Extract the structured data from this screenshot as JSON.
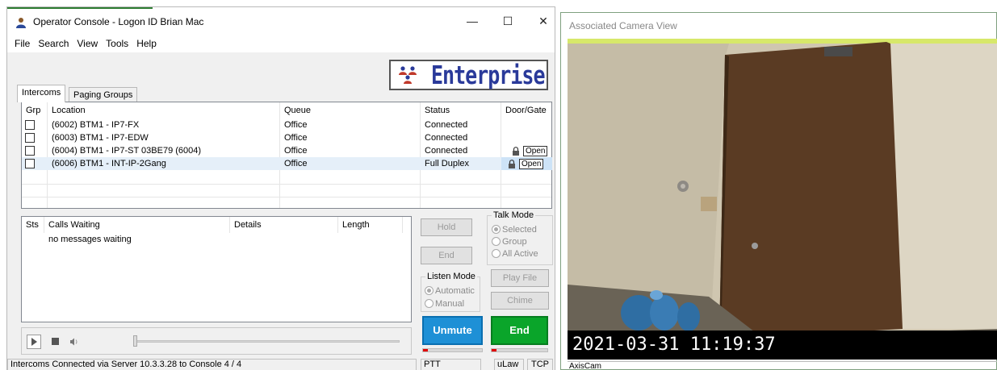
{
  "console": {
    "title": "Operator Console - Logon ID Brian Mac",
    "controls": {
      "minimize": "—",
      "maximize": "☐",
      "close": "✕"
    },
    "menu": [
      "File",
      "Search",
      "View",
      "Tools",
      "Help"
    ],
    "logo_text": "Enterprise",
    "tabs": [
      "Intercoms",
      "Paging Groups"
    ],
    "intercoms": {
      "columns": [
        "Grp",
        "Location",
        "Queue",
        "Status",
        "Door/Gate"
      ],
      "rows": [
        {
          "location": "(6002) BTM1 - IP7-FX",
          "queue": "Office",
          "status": "Connected",
          "door": ""
        },
        {
          "location": "(6003) BTM1 - IP7-EDW",
          "queue": "Office",
          "status": "Connected",
          "door": ""
        },
        {
          "location": "(6004) BTM1 - IP7-ST 03BE79 (6004)",
          "queue": "Office",
          "status": "Connected",
          "door": "Open"
        },
        {
          "location": "(6006) BTM1 - INT-IP-2Gang",
          "queue": "Office",
          "status": "Full Duplex",
          "door": "Open"
        }
      ]
    },
    "calls": {
      "columns": [
        "Sts",
        "Calls Waiting",
        "Details",
        "Length"
      ],
      "empty_text": "no messages waiting"
    },
    "buttons": {
      "hold": "Hold",
      "end": "End",
      "play_file": "Play File",
      "chime": "Chime",
      "unmute": "Unmute",
      "end_call": "End"
    },
    "talk_mode": {
      "title": "Talk Mode",
      "options": [
        "Selected",
        "Group",
        "All Active"
      ],
      "selected": "Selected"
    },
    "listen_mode": {
      "title": "Listen Mode",
      "options": [
        "Automatic",
        "Manual"
      ],
      "selected": "Automatic"
    },
    "status_bar": {
      "message": "Intercoms Connected via Server 10.3.3.28 to Console 4 / 4",
      "ptt": "PTT",
      "codec": "uLaw",
      "protocol": "TCP"
    },
    "colors": {
      "unmute": "#1e90d6",
      "end_call": "#0aa52a",
      "logo": "#2a3a9a"
    }
  },
  "camera": {
    "title": "Associated Camera View",
    "timestamp": "2021-03-31  11:19:37",
    "source": "AxisCam"
  }
}
